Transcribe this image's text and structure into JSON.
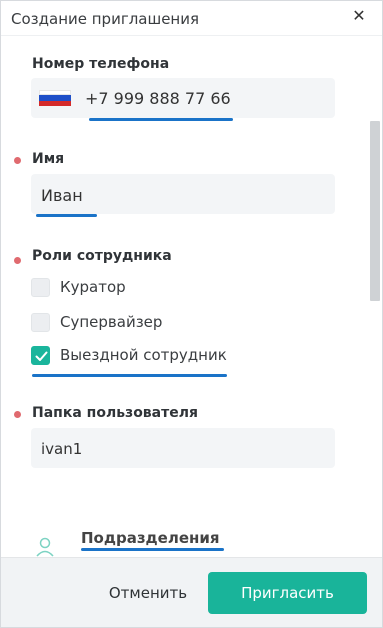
{
  "dialog": {
    "title": "Создание приглашения",
    "close_icon": "close-icon"
  },
  "phone": {
    "label": "Номер телефона",
    "value": "+7 999 888 77 66",
    "flag": "russia-flag-icon"
  },
  "name": {
    "label": "Имя",
    "value": "Иван",
    "required": true
  },
  "roles": {
    "label": "Роли сотрудника",
    "required": true,
    "items": [
      {
        "label": "Куратор",
        "checked": false
      },
      {
        "label": "Супервайзер",
        "checked": false
      },
      {
        "label": "Выездной сотрудник",
        "checked": true
      }
    ]
  },
  "folder": {
    "label": "Папка пользователя",
    "value": "ivan1",
    "required": true
  },
  "departments": {
    "label": "Подразделения",
    "icon": "users-icon"
  },
  "footer": {
    "cancel_label": "Отменить",
    "invite_label": "Пригласить"
  },
  "colors": {
    "accent": "#19b49a",
    "underline": "#1a73c8",
    "required_dot": "#e06a6f",
    "field_bg": "#f3f5f7",
    "footer_bg": "#f1f3f5"
  }
}
